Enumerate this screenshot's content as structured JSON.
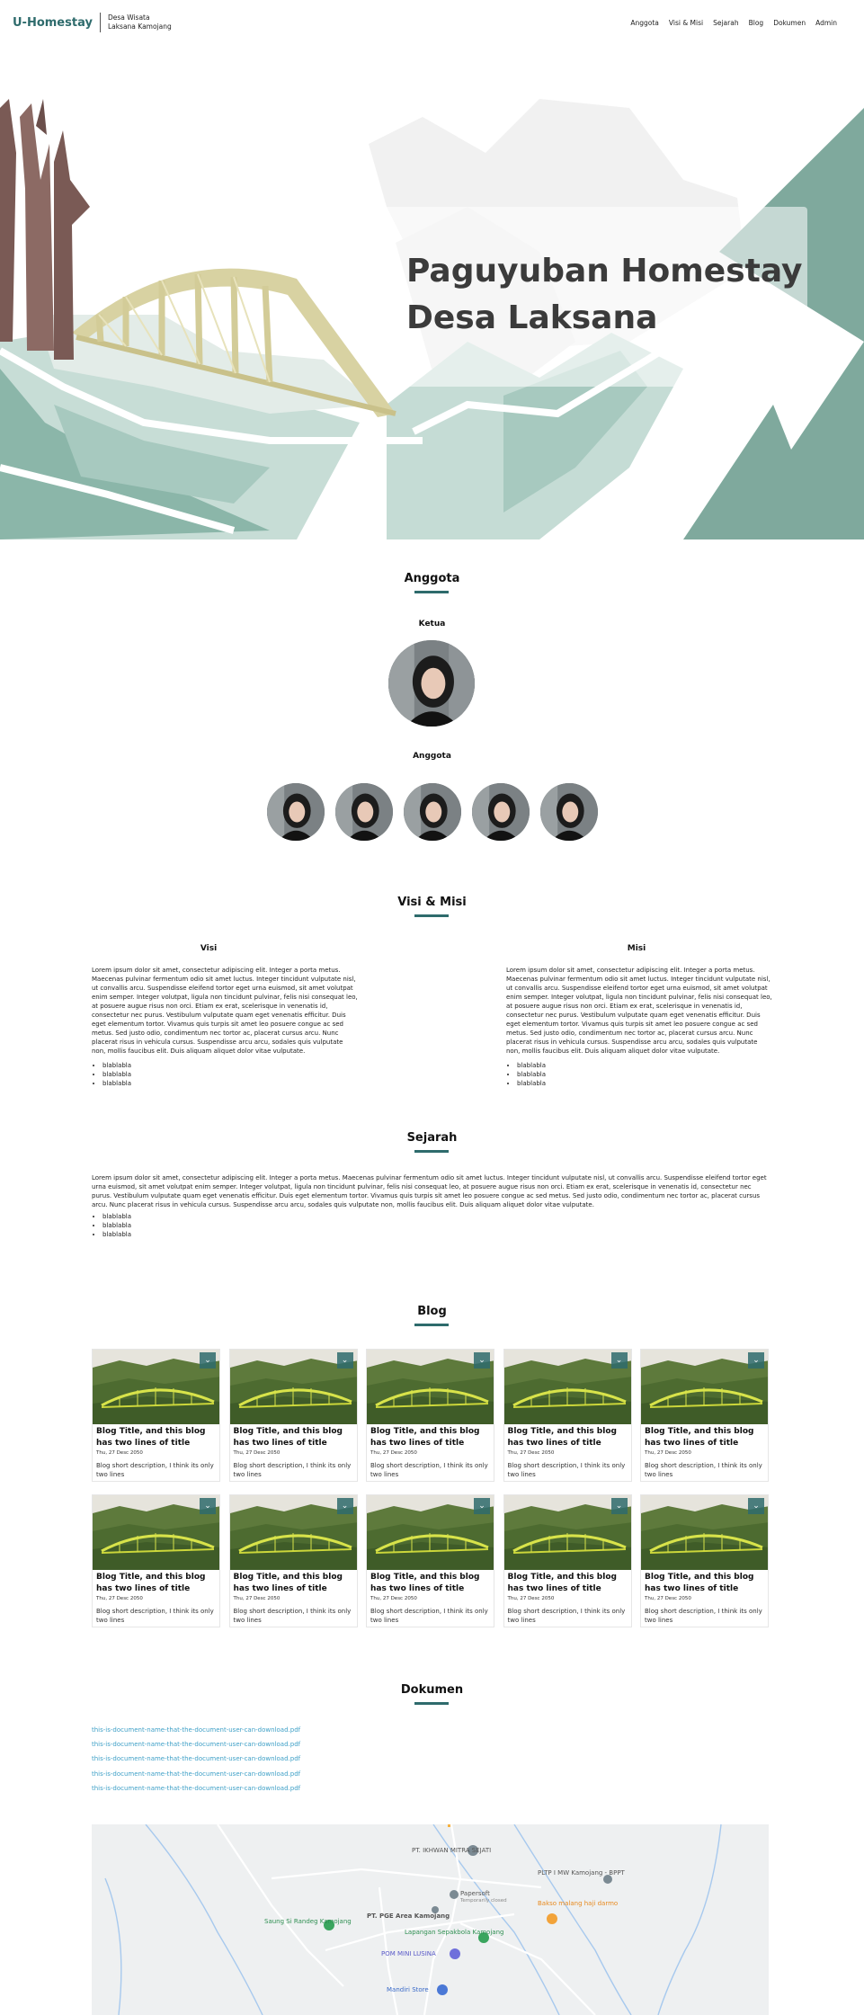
{
  "nav": {
    "brand": "U-Homestay",
    "sub_line1": "Desa Wisata",
    "sub_line2": "Laksana Kamojang",
    "links": [
      "Anggota",
      "Visi & Misi",
      "Sejarah",
      "Blog",
      "Dokumen",
      "Admin"
    ]
  },
  "hero": {
    "title_line1": "Paguyuban Homestay",
    "title_line2": "Desa Laksana"
  },
  "anggota": {
    "title": "Anggota",
    "ketua_label": "Ketua",
    "anggota_label": "Anggota"
  },
  "visi_misi": {
    "title": "Visi & Misi",
    "visi_title": "Visi",
    "misi_title": "Misi",
    "visi_text": "Lorem ipsum dolor sit amet, consectetur adipiscing elit. Integer a porta metus. Maecenas pulvinar fermentum odio sit amet luctus. Integer tincidunt vulputate nisl, ut convallis arcu. Suspendisse eleifend tortor eget urna euismod, sit amet volutpat enim semper. Integer volutpat, ligula non tincidunt pulvinar, felis nisi consequat leo, at posuere augue risus non orci. Etiam ex erat, scelerisque in venenatis id, consectetur nec purus. Vestibulum vulputate quam eget venenatis efficitur. Duis eget elementum tortor. Vivamus quis turpis sit amet leo posuere congue ac sed metus. Sed justo odio, condimentum nec tortor ac, placerat cursus arcu. Nunc placerat risus in vehicula cursus. Suspendisse arcu arcu, sodales quis vulputate non, mollis faucibus elit. Duis aliquam aliquet dolor vitae vulputate.",
    "misi_text": "Lorem ipsum dolor sit amet, consectetur adipiscing elit. Integer a porta metus. Maecenas pulvinar fermentum odio sit amet luctus. Integer tincidunt vulputate nisl, ut convallis arcu. Suspendisse eleifend tortor eget urna euismod, sit amet volutpat enim semper. Integer volutpat, ligula non tincidunt pulvinar, felis nisi consequat leo, at posuere augue risus non orci. Etiam ex erat, scelerisque in venenatis id, consectetur nec purus. Vestibulum vulputate quam eget venenatis efficitur. Duis eget elementum tortor. Vivamus quis turpis sit amet leo posuere congue ac sed metus. Sed justo odio, condimentum nec tortor ac, placerat cursus arcu. Nunc placerat risus in vehicula cursus. Suspendisse arcu arcu, sodales quis vulputate non, mollis faucibus elit. Duis aliquam aliquet dolor vitae vulputate.",
    "visi_bullets": [
      "blablabla",
      "blablabla",
      "blablabla"
    ],
    "misi_bullets": [
      "blablabla",
      "blablabla",
      "blablabla"
    ]
  },
  "sejarah": {
    "title": "Sejarah",
    "text": "Lorem ipsum dolor sit amet, consectetur adipiscing elit. Integer a porta metus. Maecenas pulvinar fermentum odio sit amet luctus. Integer tincidunt vulputate nisl, ut convallis arcu. Suspendisse eleifend tortor eget urna euismod, sit amet volutpat enim semper. Integer volutpat, ligula non tincidunt pulvinar, felis nisi consequat leo, at posuere augue risus non orci. Etiam ex erat, scelerisque in venenatis id, consectetur nec purus. Vestibulum vulputate quam eget venenatis efficitur. Duis eget elementum tortor. Vivamus quis turpis sit amet leo posuere congue ac sed metus. Sed justo odio, condimentum nec tortor ac, placerat cursus arcu. Nunc placerat risus in vehicula cursus. Suspendisse arcu arcu, sodales quis vulputate non, mollis faucibus elit. Duis aliquam aliquet dolor vitae vulputate.",
    "bullets": [
      "blablabla",
      "blablabla",
      "blablabla"
    ]
  },
  "blog": {
    "title": "Blog",
    "badge_icon": "chevron-down-icon",
    "cards": [
      {
        "title": "Blog Title, and this blog has two lines of title",
        "date": "Thu, 27 Desc 2050",
        "desc": "Blog short description, I think its only two lines"
      },
      {
        "title": "Blog Title, and this blog has two lines of title",
        "date": "Thu, 27 Desc 2050",
        "desc": "Blog short description, I think its only two lines"
      },
      {
        "title": "Blog Title, and this blog has two lines of title",
        "date": "Thu, 27 Desc 2050",
        "desc": "Blog short description, I think its only two lines"
      },
      {
        "title": "Blog Title, and this blog has two lines of title",
        "date": "Thu, 27 Desc 2050",
        "desc": "Blog short description, I think its only two lines"
      },
      {
        "title": "Blog Title, and this blog has two lines of title",
        "date": "Thu, 27 Desc 2050",
        "desc": "Blog short description, I think its only two lines"
      },
      {
        "title": "Blog Title, and this blog has two lines of title",
        "date": "Thu, 27 Desc 2050",
        "desc": "Blog short description, I think its only two lines"
      },
      {
        "title": "Blog Title, and this blog has two lines of title",
        "date": "Thu, 27 Desc 2050",
        "desc": "Blog short description, I think its only two lines"
      },
      {
        "title": "Blog Title, and this blog has two lines of title",
        "date": "Thu, 27 Desc 2050",
        "desc": "Blog short description, I think its only two lines"
      },
      {
        "title": "Blog Title, and this blog has two lines of title",
        "date": "Thu, 27 Desc 2050",
        "desc": "Blog short description, I think its only two lines"
      },
      {
        "title": "Blog Title, and this blog has two lines of title",
        "date": "Thu, 27 Desc 2050",
        "desc": "Blog short description, I think its only two lines"
      }
    ]
  },
  "dokumen": {
    "title": "Dokumen",
    "files": [
      "this-is-document-name-that-the-document-user-can-download.pdf",
      "this-is-document-name-that-the-document-user-can-download.pdf",
      "this-is-document-name-that-the-document-user-can-download.pdf",
      "this-is-document-name-that-the-document-user-can-download.pdf",
      "this-is-document-name-that-the-document-user-can-download.pdf"
    ]
  },
  "map": {
    "labels": {
      "ikhwan": "PT. IKHWAN MITRA SEJATI",
      "papersoft": "Papersoft",
      "papersoft_status": "Temporarily closed",
      "pltp": "PLTP I MW Kamojang - BPPT",
      "bakso": "Bakso malang haji darmo",
      "saung": "Saung Si Randeg Kamojang",
      "pge": "PT. PGE Area Kamojang",
      "lapangan": "Lapangan Sepakbola Kamojang",
      "pom": "POM MINI LUSINA",
      "mandiri": "Mandiri Store"
    }
  },
  "colors": {
    "brand": "#2e6b6c",
    "link": "#3fa0c7"
  }
}
